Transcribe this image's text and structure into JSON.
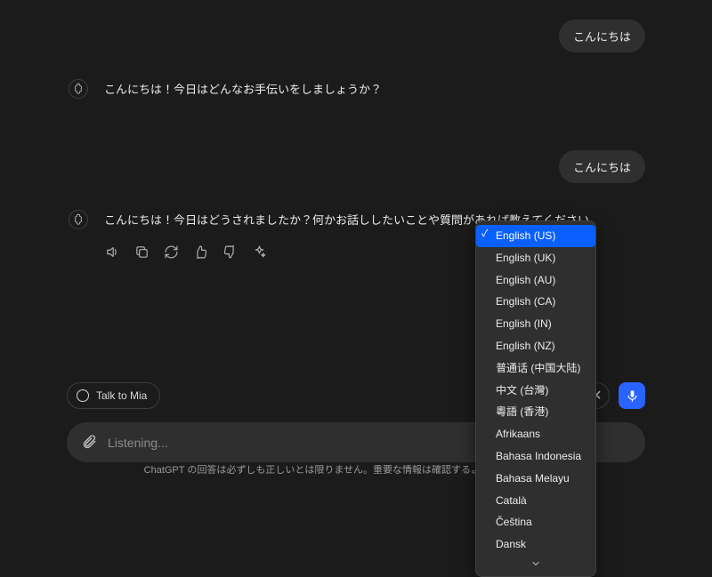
{
  "messages": {
    "user1": "こんにちは",
    "asst1": "こんにちは！今日はどんなお手伝いをしましょうか？",
    "user2": "こんにちは",
    "asst2": "こんにちは！今日はどうされましたか？何かお話ししたいことや質問があれば教えてください。"
  },
  "talk_button": "Talk to Mia",
  "input": {
    "placeholder": "Listening..."
  },
  "footer": "ChatGPT の回答は必ずしも正しいとは限りません。重要な情報は確認するようにしてください。",
  "language_menu": {
    "selected": "English (US)",
    "items": [
      "English (US)",
      "English (UK)",
      "English (AU)",
      "English (CA)",
      "English (IN)",
      "English (NZ)",
      "普通话 (中国大陆)",
      "中文 (台灣)",
      "粵語 (香港)",
      "Afrikaans",
      "Bahasa Indonesia",
      "Bahasa Melayu",
      "Català",
      "Čeština",
      "Dansk"
    ]
  },
  "colors": {
    "accent": "#2a63ff",
    "select": "#0a60ff"
  }
}
